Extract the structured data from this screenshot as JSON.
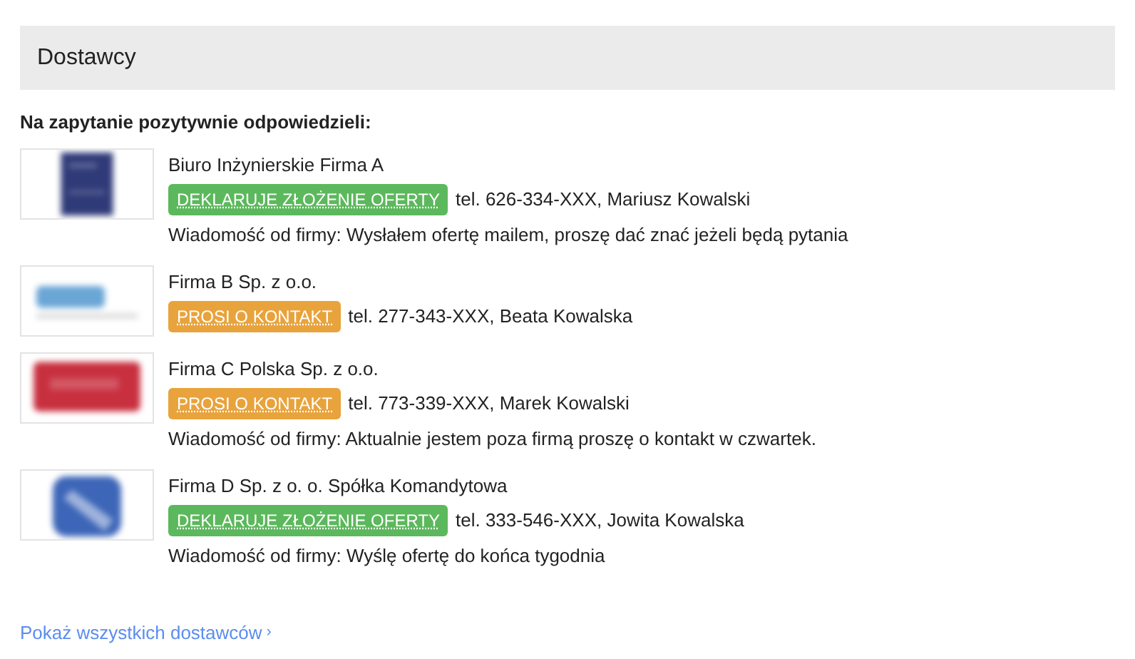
{
  "panel": {
    "title": "Dostawcy"
  },
  "intro": "Na zapytanie pozytywnie odpowiedzieli:",
  "suppliers": [
    {
      "name": "Biuro Inżynierskie Firma A",
      "status": {
        "kind": "offer",
        "label": "DEKLARUJE ZŁOŻENIE OFERTY"
      },
      "contact": "tel. 626-334-XXX, Mariusz Kowalski",
      "message": "Wiadomość od firmy: Wysłałem ofertę mailem, proszę dać znać jeżeli będą pytania"
    },
    {
      "name": "Firma B Sp. z o.o.",
      "status": {
        "kind": "contact",
        "label": "PROSI O KONTAKT"
      },
      "contact": "tel. 277-343-XXX, Beata Kowalska"
    },
    {
      "name": "Firma C Polska Sp. z o.o.",
      "status": {
        "kind": "contact",
        "label": "PROSI O KONTAKT"
      },
      "contact": "tel. 773-339-XXX, Marek Kowalski",
      "message": "Wiadomość od firmy: Aktualnie jestem poza firmą proszę o kontakt w czwartek."
    },
    {
      "name": "Firma D Sp. z o. o. Spółka Komandytowa",
      "status": {
        "kind": "offer",
        "label": "DEKLARUJE ZŁOŻENIE OFERTY"
      },
      "contact": "tel. 333-546-XXX, Jowita Kowalska",
      "message": "Wiadomość od firmy: Wyślę ofertę do końca tygodnia"
    }
  ],
  "footer_link": {
    "label": "Pokaż wszystkich dostawców",
    "arrow": "›"
  }
}
